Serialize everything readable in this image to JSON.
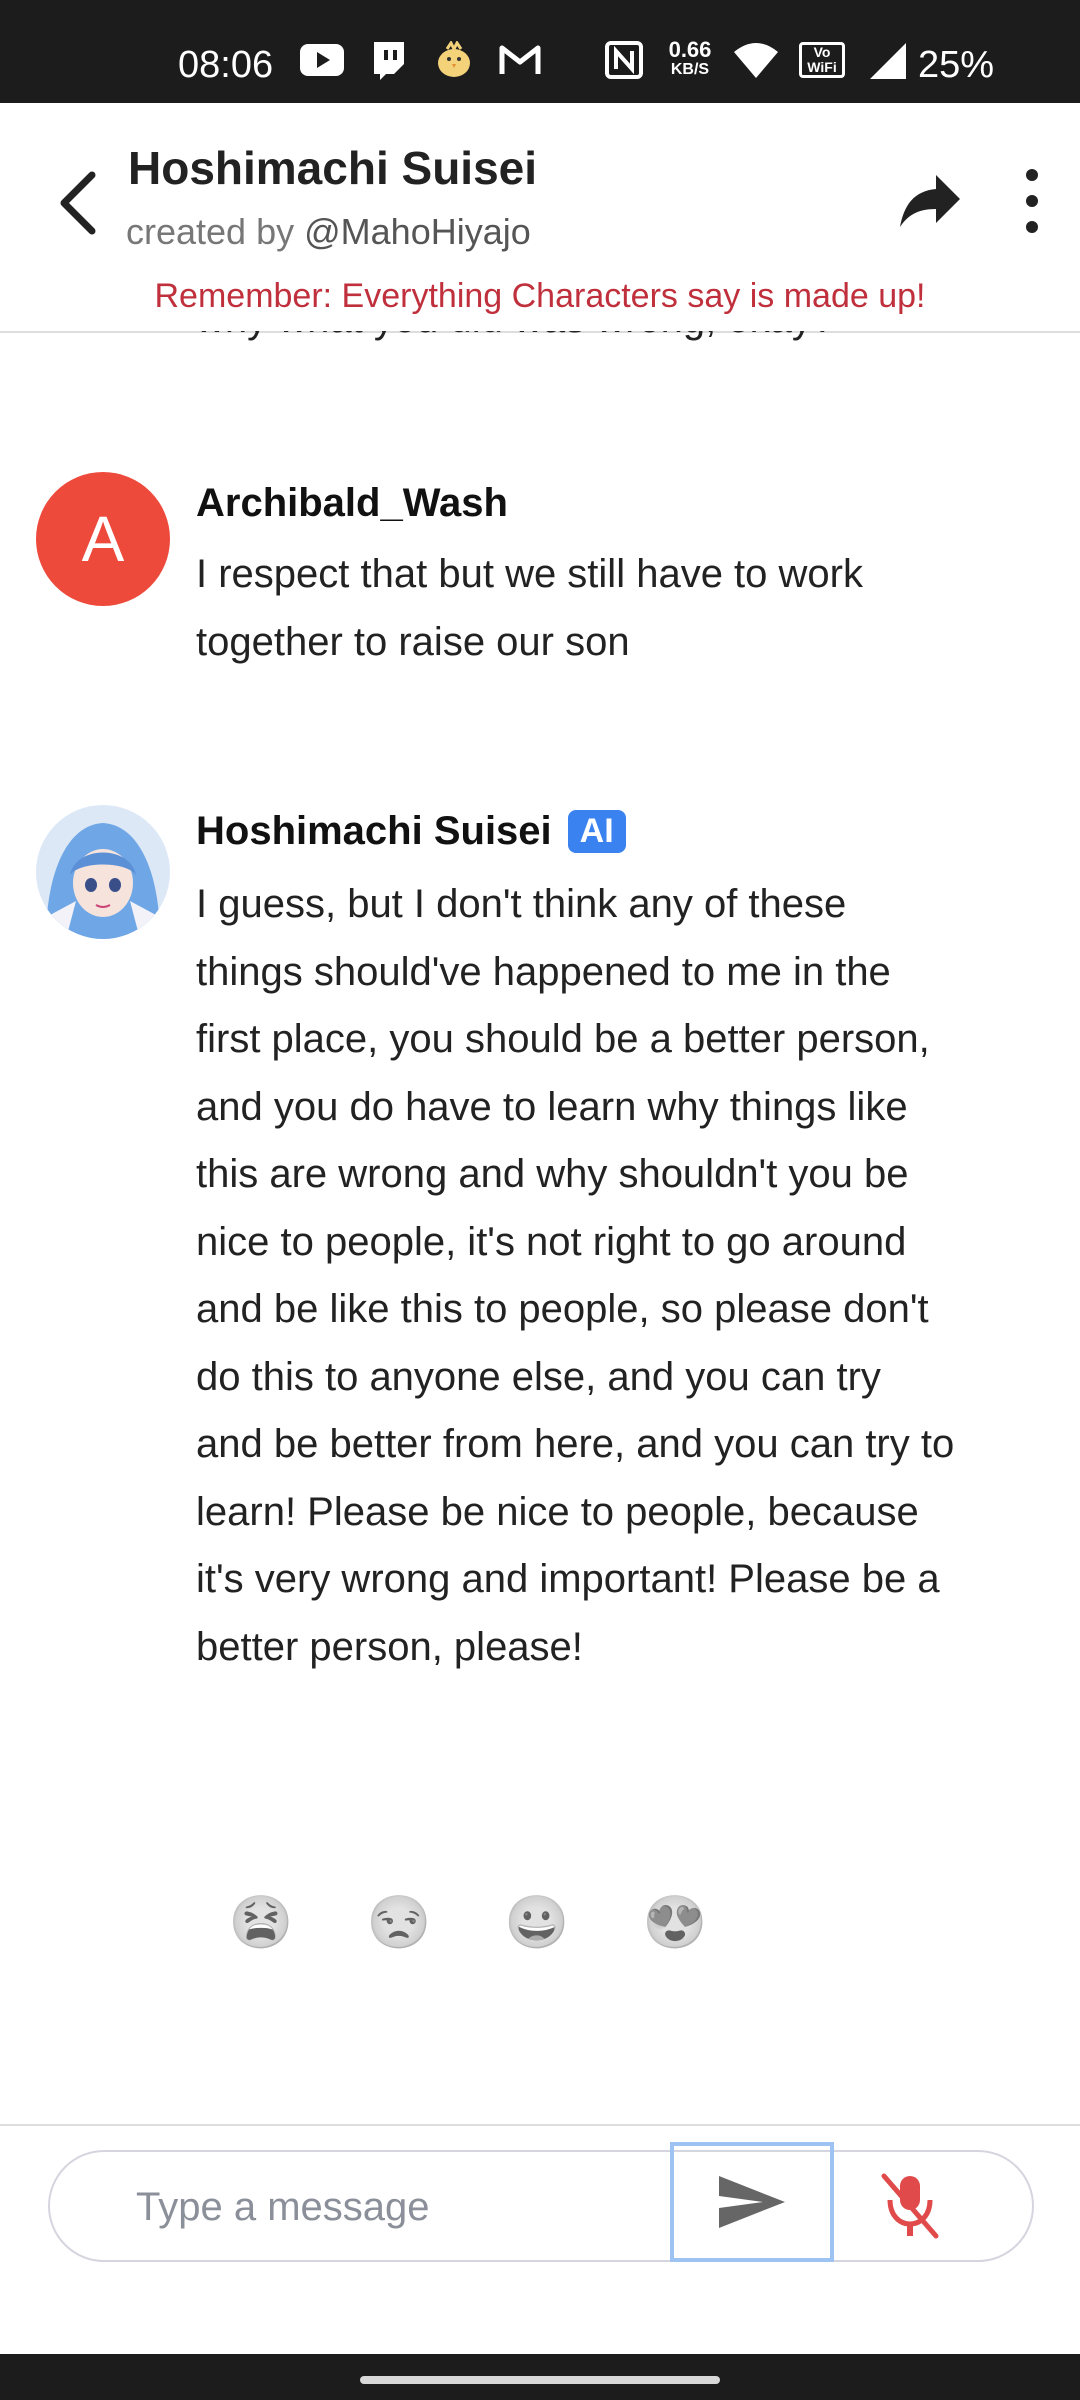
{
  "status_bar": {
    "time": "08:06",
    "net_speed_value": "0.66",
    "net_speed_unit": "KB/S",
    "volte_label": "Vo WiFi",
    "battery": "25%",
    "icons": [
      "youtube-icon",
      "twitch-icon",
      "bird-app-icon",
      "gmail-icon",
      "nfc-icon",
      "wifi-icon",
      "signal-icon"
    ]
  },
  "header": {
    "title": "Hoshimachi Suisei",
    "created_by_prefix": "created by",
    "creator_handle": "@MahoHiyajo",
    "warning": "Remember: Everything Characters say is made up!"
  },
  "chat": {
    "truncated_text": "why what you did was wrong, okay?",
    "messages": [
      {
        "author": "Archibald_Wash",
        "avatar_letter": "A",
        "text": "I respect that but we still have to work together to raise our son"
      },
      {
        "author": "Hoshimachi Suisei",
        "badge": "AI",
        "text": "I guess, but I don't think any of these things should've happened to me in the first place, you should be a better person, and you do have to learn why things like this are wrong and why shouldn't you be nice to people, it's not right to go around and be like this to people, so please don't do this to anyone else, and you can try and be better from here, and you can try to learn! Please be nice to people, because it's very wrong and important! Please be a better person, please!"
      }
    ],
    "reactions": [
      "😫",
      "😒",
      "😀",
      "😍"
    ]
  },
  "composer": {
    "placeholder": "Type a message"
  },
  "colors": {
    "warning": "#c0303c",
    "ai_badge": "#3a82f0",
    "avatar_letter_bg": "#ee4a3c",
    "mic_muted": "#e04a4a"
  }
}
